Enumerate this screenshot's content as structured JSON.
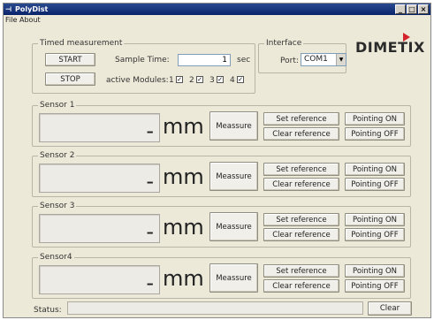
{
  "window": {
    "title": "PolyDist",
    "icon": "polydist-app-icon",
    "controls": [
      "minimize",
      "maximize",
      "close"
    ],
    "control_glyphs": [
      "_",
      "□",
      "×"
    ]
  },
  "menu": {
    "file": "File",
    "about": "About"
  },
  "timed": {
    "legend": "Timed measurement",
    "start": "START",
    "stop": "STOP",
    "sample_time_label": "Sample Time:",
    "sample_time_value": "1",
    "sample_time_unit": "sec",
    "active_modules_label": "active Modules:",
    "modules": [
      {
        "label": "1",
        "checked": true
      },
      {
        "label": "2",
        "checked": true
      },
      {
        "label": "3",
        "checked": true
      },
      {
        "label": "4",
        "checked": true
      }
    ]
  },
  "interface": {
    "legend": "Interface",
    "port_label": "Port:",
    "port_value": "COM1"
  },
  "brand": {
    "logo_text": "DIMETIX",
    "accent_color": "#d5232e"
  },
  "sensors": [
    {
      "legend": "Sensor 1",
      "value": "-",
      "unit": "mm",
      "measure": "Meassure",
      "set_ref": "Set reference",
      "clear_ref": "Clear reference",
      "pointing_on": "Pointing ON",
      "pointing_off": "Pointing OFF"
    },
    {
      "legend": "Sensor 2",
      "value": "-",
      "unit": "mm",
      "measure": "Meassure",
      "set_ref": "Set reference",
      "clear_ref": "Clear reference",
      "pointing_on": "Pointing ON",
      "pointing_off": "Pointing OFF"
    },
    {
      "legend": "Sensor 3",
      "value": "-",
      "unit": "mm",
      "measure": "Meassure",
      "set_ref": "Set reference",
      "clear_ref": "Clear reference",
      "pointing_on": "Pointing ON",
      "pointing_off": "Pointing OFF"
    },
    {
      "legend": "Sensor4",
      "value": "-",
      "unit": "mm",
      "measure": "Meassure",
      "set_ref": "Set reference",
      "clear_ref": "Clear reference",
      "pointing_on": "Pointing ON",
      "pointing_off": "Pointing OFF"
    }
  ],
  "status": {
    "label": "Status:",
    "value": "",
    "clear": "Clear"
  }
}
